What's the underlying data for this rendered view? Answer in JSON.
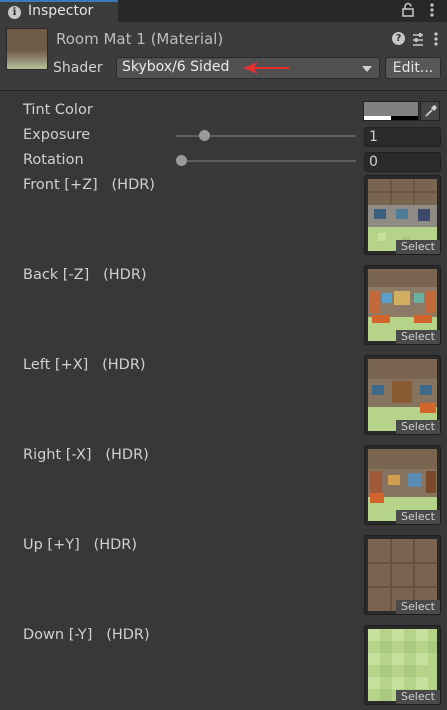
{
  "tab": {
    "title": "Inspector",
    "info_icon": "i"
  },
  "header": {
    "material_title": "Room Mat 1 (Material)",
    "help_icon": "?",
    "shader_label": "Shader",
    "shader_value": "Skybox/6 Sided",
    "edit_label": "Edit..."
  },
  "properties": {
    "tint": {
      "label": "Tint Color",
      "color": "#818181"
    },
    "exposure": {
      "label": "Exposure",
      "value": "1",
      "slider_fraction": 0.125
    },
    "rotation": {
      "label": "Rotation",
      "value": "0",
      "slider_fraction": 0.0
    }
  },
  "textures": [
    {
      "label": "Front [+Z]   (HDR)",
      "select": "Select"
    },
    {
      "label": "Back [-Z]   (HDR)",
      "select": "Select"
    },
    {
      "label": "Left [+X]   (HDR)",
      "select": "Select"
    },
    {
      "label": "Right [-X]   (HDR)",
      "select": "Select"
    },
    {
      "label": "Up [+Y]   (HDR)",
      "select": "Select"
    },
    {
      "label": "Down [-Y]   (HDR)",
      "select": "Select"
    }
  ],
  "colors": {
    "background": "#383838",
    "tab_accent": "#3a79bb",
    "arrow": "#e8312f",
    "floor_green": "#b5d48a",
    "wall_brown": "#6e5c48"
  }
}
